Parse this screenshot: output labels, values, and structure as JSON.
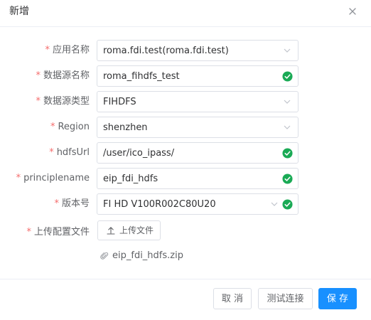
{
  "dialog": {
    "title": "新增"
  },
  "form": {
    "required_mark": "*",
    "fields": [
      {
        "label": "应用名称",
        "value": "roma.fdi.test(roma.fdi.test)",
        "type": "select",
        "valid": false
      },
      {
        "label": "数据源名称",
        "value": "roma_fihdfs_test",
        "type": "input",
        "valid": true
      },
      {
        "label": "数据源类型",
        "value": "FIHDFS",
        "type": "select",
        "valid": false
      },
      {
        "label": "Region",
        "value": "shenzhen",
        "type": "select",
        "valid": false
      },
      {
        "label": "hdfsUrl",
        "value": "/user/ico_ipass/",
        "type": "input",
        "valid": true
      },
      {
        "label": "principlename",
        "value": "eip_fdi_hdfs",
        "type": "input",
        "valid": true
      },
      {
        "label": "版本号",
        "value": "FI HD V100R002C80U20",
        "type": "select",
        "valid": true
      }
    ],
    "upload": {
      "label": "上传配置文件",
      "button_label": "上传文件",
      "file_name": "eip_fdi_hdfs.zip"
    }
  },
  "footer": {
    "cancel_label": "取 消",
    "test_label": "测试连接",
    "save_label": "保 存"
  },
  "colors": {
    "primary": "#1890ff",
    "success": "#1aaa55",
    "required": "#f56c6c",
    "border": "#dcdfe6",
    "divider": "#ebeef5"
  },
  "icons": {
    "close": "close-icon",
    "chevron": "chevron-down-icon",
    "valid": "check-circle-icon",
    "upload": "upload-icon",
    "attachment": "paperclip-icon"
  }
}
